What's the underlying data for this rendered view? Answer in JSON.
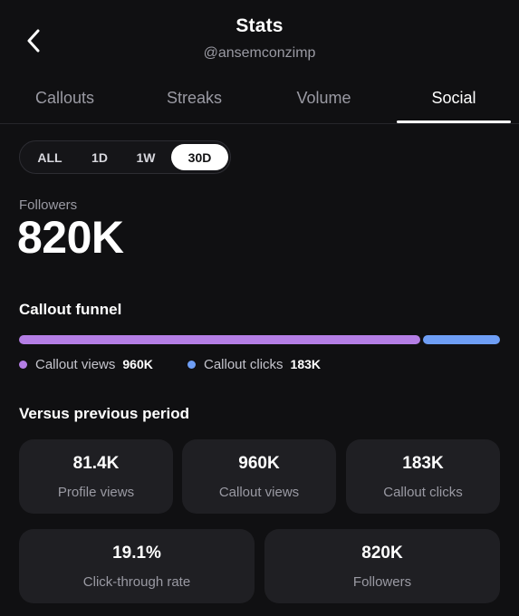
{
  "header": {
    "title": "Stats",
    "handle": "@ansemconzimp",
    "back_icon": "chevron-left-icon"
  },
  "tabs": [
    {
      "label": "Callouts",
      "active": false
    },
    {
      "label": "Streaks",
      "active": false
    },
    {
      "label": "Volume",
      "active": false
    },
    {
      "label": "Social",
      "active": true
    }
  ],
  "range": {
    "options": [
      "ALL",
      "1D",
      "1W",
      "30D"
    ],
    "selected": "30D"
  },
  "followers": {
    "label": "Followers",
    "value": "820K"
  },
  "funnel": {
    "title": "Callout funnel",
    "views": {
      "label": "Callout views",
      "value": "960K",
      "color": "#b47ee5"
    },
    "clicks": {
      "label": "Callout clicks",
      "value": "183K",
      "color": "#6e9ef5"
    },
    "views_share": 0.84
  },
  "comparison": {
    "title": "Versus previous period",
    "cards": [
      {
        "value": "81.4K",
        "label": "Profile views"
      },
      {
        "value": "960K",
        "label": "Callout views"
      },
      {
        "value": "183K",
        "label": "Callout clicks"
      },
      {
        "value": "19.1%",
        "label": "Click-through rate"
      },
      {
        "value": "820K",
        "label": "Followers"
      }
    ]
  },
  "colors": {
    "background": "#101012",
    "card": "#1f1f23",
    "muted_text": "#9a9aa3"
  }
}
